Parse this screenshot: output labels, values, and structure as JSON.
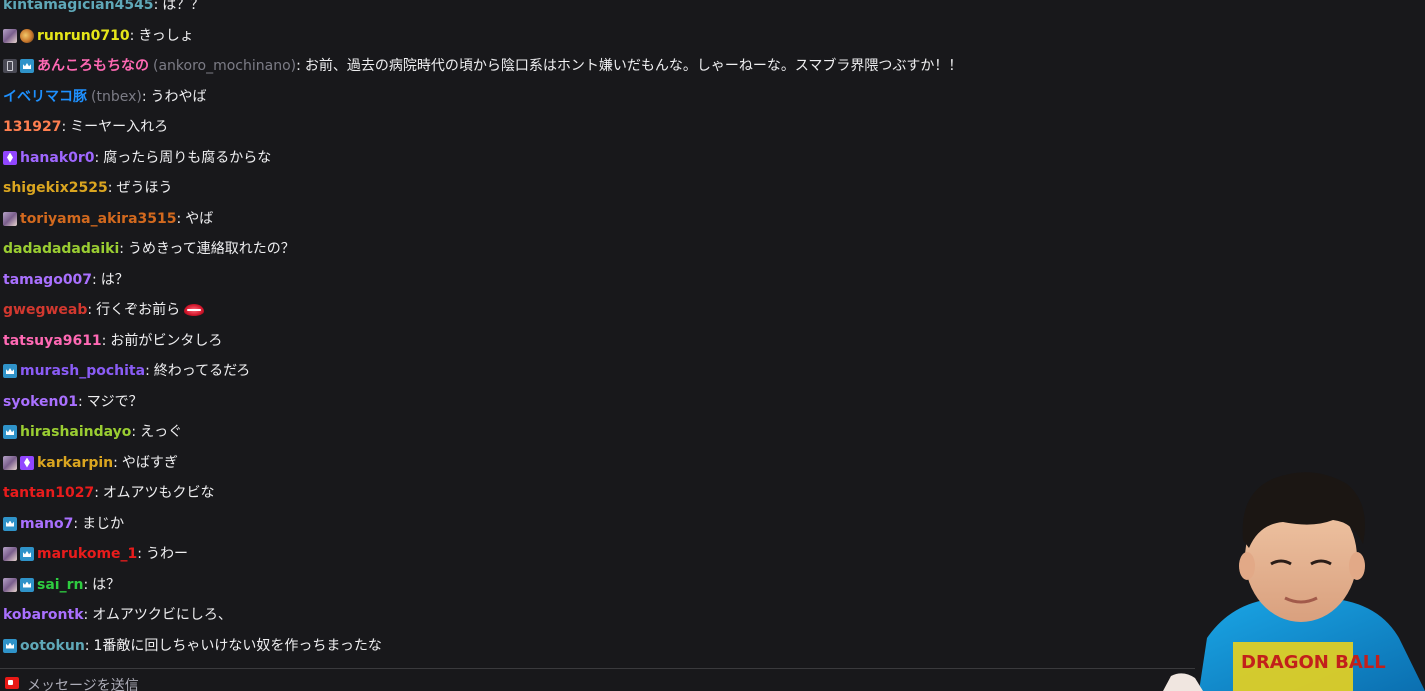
{
  "chat": {
    "messages": [
      {
        "badges": [],
        "display": "kintamagician4545",
        "login": "",
        "color": "#5fa8b8",
        "text": "は？？"
      },
      {
        "badges": [
          "avatar",
          "cheer"
        ],
        "display": "runrun0710",
        "login": "",
        "color": "#e6e619",
        "text": "きっしょ"
      },
      {
        "badges": [
          "phone",
          "crown"
        ],
        "display": "あんころもちなの",
        "login": "(ankoro_mochinano)",
        "color": "#ff69b4",
        "text": "お前、過去の病院時代の頃から陰口系はホント嫌いだもんな。しゃーねーな。スマブラ界隈つぶすか！！"
      },
      {
        "badges": [],
        "display": "イベリマコ豚",
        "login": "(tnbex)",
        "color": "#1e90ff",
        "text": "うわやば"
      },
      {
        "badges": [],
        "display": "131927",
        "login": "",
        "color": "#ff7f50",
        "text": "ミーヤー入れろ"
      },
      {
        "badges": [
          "gem"
        ],
        "display": "hanak0r0",
        "login": "",
        "color": "#9f67ff",
        "text": "腐ったら周りも腐るからな"
      },
      {
        "badges": [],
        "display": "shigekix2525",
        "login": "",
        "color": "#daa520",
        "text": "ぜうほう"
      },
      {
        "badges": [
          "avatar"
        ],
        "display": "toriyama_akira3515",
        "login": "",
        "color": "#d2691e",
        "text": "やば"
      },
      {
        "badges": [],
        "display": "dadadadadaiki",
        "login": "",
        "color": "#9acd32",
        "text": "うめきって連絡取れたの？"
      },
      {
        "badges": [],
        "display": "tamago007",
        "login": "",
        "color": "#a970ff",
        "text": "は？"
      },
      {
        "badges": [],
        "display": "gwegweab",
        "login": "",
        "color": "#d2382f",
        "text": "行くぞお前ら",
        "emote": true
      },
      {
        "badges": [],
        "display": "tatsuya9611",
        "login": "",
        "color": "#ff69b4",
        "text": "お前がビンタしろ"
      },
      {
        "badges": [
          "crown"
        ],
        "display": "murash_pochita",
        "login": "",
        "color": "#8a5cf6",
        "text": "終わってるだろ"
      },
      {
        "badges": [],
        "display": "syoken01",
        "login": "",
        "color": "#a970ff",
        "text": "マジで？"
      },
      {
        "badges": [
          "crown"
        ],
        "display": "hirashaindayo",
        "login": "",
        "color": "#9acd32",
        "text": "えっぐ"
      },
      {
        "badges": [
          "avatar",
          "gem"
        ],
        "display": "karkarpin",
        "login": "",
        "color": "#daa520",
        "text": "やばすぎ"
      },
      {
        "badges": [],
        "display": "tantan1027",
        "login": "",
        "color": "#e81c1c",
        "text": "オムアツもクビな"
      },
      {
        "badges": [
          "crown"
        ],
        "display": "mano7",
        "login": "",
        "color": "#a970ff",
        "text": "まじか"
      },
      {
        "badges": [
          "avatar",
          "crown"
        ],
        "display": "marukome_1",
        "login": "",
        "color": "#e81c1c",
        "text": "うわー"
      },
      {
        "badges": [
          "avatar",
          "crown"
        ],
        "display": "sai_rn",
        "login": "",
        "color": "#2ecc40",
        "text": "は？"
      },
      {
        "badges": [],
        "display": "kobarontk",
        "login": "",
        "color": "#a970ff",
        "text": "オムアツクビにしろ、"
      },
      {
        "badges": [
          "crown"
        ],
        "display": "ootokun",
        "login": "",
        "color": "#5fa8b8",
        "text": "1番敵に回しちゃいけない奴を作っちまったな"
      }
    ]
  },
  "input": {
    "placeholder": "メッセージを送信",
    "icon": "record-icon"
  },
  "webcam": {
    "shirt_text": "DRAGON BALL"
  }
}
